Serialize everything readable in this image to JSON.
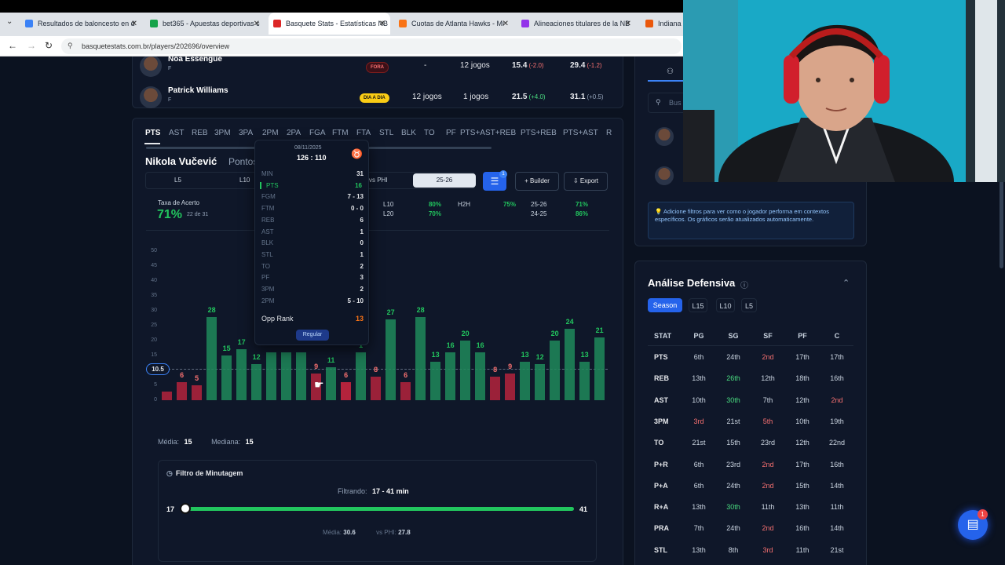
{
  "browser": {
    "tabs": [
      {
        "title": "Resultados de baloncesto en d",
        "color": "#3b82f6"
      },
      {
        "title": "bet365 - Apuestas deportivas c",
        "color": "#16a34a"
      },
      {
        "title": "Basquete Stats - Estatísticas NB",
        "color": "#dc2626"
      },
      {
        "title": "Cuotas de Atlanta Hawks - Mi",
        "color": "#f97316"
      },
      {
        "title": "Alineaciones titulares de la NB",
        "color": "#9333ea"
      },
      {
        "title": "Indiana I",
        "color": "#ea580c"
      }
    ],
    "url": "basquetestats.com.br/players/202696/overview"
  },
  "players": [
    {
      "name": "Noa Essengue",
      "pos": "F",
      "status": "FORA",
      "games": "-",
      "games2": "12 jogos",
      "val1": "15.4",
      "d1": "(-2.0)",
      "val2": "29.4",
      "d2": "(-1.2)"
    },
    {
      "name": "Patrick Williams",
      "pos": "F",
      "status": "DIA A DIA",
      "games": "12 jogos",
      "games2": "1 jogos",
      "val1": "21.5",
      "d1": "(+4.0)",
      "val2": "31.1",
      "d2": "(+0.5)"
    }
  ],
  "stat_tabs": [
    "PTS",
    "AST",
    "REB",
    "3PM",
    "3PA",
    "2PM",
    "2PA",
    "FGA",
    "FTM",
    "FTA",
    "STL",
    "BLK",
    "TO",
    "PF",
    "PTS+AST+REB",
    "PTS+REB",
    "PTS+AST",
    "R"
  ],
  "player": {
    "name": "Nikola Vučević",
    "subtitle": "Pontos",
    "filters": [
      "L5",
      "L10",
      "vs PHI",
      "25-26"
    ],
    "filter_badge": "1",
    "builder": "Builder",
    "export": "Export",
    "hit_rate_label": "Taxa de Acerto",
    "hit_rate": "71%",
    "hit_rate_sub": "22 de 31",
    "splits": [
      {
        "k": "L10",
        "v": "80%"
      },
      {
        "k": "L20",
        "v": "70%"
      },
      {
        "k": "H2H",
        "v": "75%"
      },
      {
        "k": "25-26",
        "v": "71%"
      },
      {
        "k": "24-25",
        "v": "86%"
      }
    ]
  },
  "tooltip": {
    "date": "08/11/2025",
    "score": "126 : 110",
    "rows": [
      {
        "k": "MIN",
        "v": "31"
      },
      {
        "k": "PTS",
        "v": "16"
      },
      {
        "k": "FGM",
        "v": "7 - 13"
      },
      {
        "k": "FTM",
        "v": "0 - 0"
      },
      {
        "k": "REB",
        "v": "6"
      },
      {
        "k": "AST",
        "v": "1"
      },
      {
        "k": "BLK",
        "v": "0"
      },
      {
        "k": "STL",
        "v": "1"
      },
      {
        "k": "TO",
        "v": "2"
      },
      {
        "k": "PF",
        "v": "3"
      },
      {
        "k": "3PM",
        "v": "2"
      },
      {
        "k": "2PM",
        "v": "5 - 10"
      }
    ],
    "opp_rank_label": "Opp Rank",
    "opp_rank": "13",
    "tag": "Regular"
  },
  "chart_data": {
    "type": "bar",
    "ylim": [
      0,
      50
    ],
    "yticks": [
      0,
      5,
      10,
      15,
      20,
      25,
      30,
      35,
      40,
      45,
      50
    ],
    "line": 10.5,
    "line_label": "10.5",
    "values": [
      3,
      6,
      5,
      28,
      15,
      17,
      12,
      16,
      16,
      16,
      9,
      11,
      6,
      16,
      8,
      27,
      6,
      28,
      13,
      16,
      20,
      16,
      8,
      9,
      13,
      12,
      20,
      24,
      13,
      21
    ],
    "labels_shown": {
      "1": "6",
      "2": "5",
      "3": "28",
      "4": "15",
      "5": "17",
      "6": "12",
      "10": "9",
      "11": "11",
      "12": "6",
      "13": "1",
      "14": "8",
      "15": "27",
      "16": "6",
      "17": "28",
      "18": "13",
      "19": "16",
      "20": "20",
      "21": "16",
      "22": "8",
      "23": "9",
      "24": "13",
      "25": "12",
      "26": "20",
      "27": "24",
      "28": "13",
      "29": "21"
    },
    "hit_color": "#1f8a5b",
    "miss_color": "#b4233c"
  },
  "summary": {
    "media_label": "Média:",
    "media": "15",
    "mediana_label": "Mediana:",
    "mediana": "15"
  },
  "minutes_filter": {
    "title": "Filtro de Minutagem",
    "filtering_label": "Filtrando:",
    "filtering": "17 - 41 min",
    "min": "17",
    "max": "41",
    "avg_label": "Média:",
    "avg": "30.6",
    "vs_label": "vs PHI:",
    "vs": "27.8"
  },
  "sidebar": {
    "search_placeholder": "Bus",
    "hint": "Adicione filtros para ver como o jogador performa em contextos específicos. Os gráficos serão atualizados automaticamente.",
    "defense_title": "Análise Defensiva",
    "periods": [
      "Season",
      "L15",
      "L10",
      "L5"
    ],
    "columns": [
      "STAT",
      "PG",
      "SG",
      "SF",
      "PF",
      "C"
    ],
    "rows": [
      {
        "stat": "PTS",
        "v": [
          "6th",
          "24th",
          "2nd",
          "17th",
          "17th"
        ]
      },
      {
        "stat": "REB",
        "v": [
          "13th",
          "26th",
          "12th",
          "18th",
          "16th"
        ]
      },
      {
        "stat": "AST",
        "v": [
          "10th",
          "30th",
          "7th",
          "12th",
          "2nd"
        ]
      },
      {
        "stat": "3PM",
        "v": [
          "3rd",
          "21st",
          "5th",
          "10th",
          "19th"
        ]
      },
      {
        "stat": "TO",
        "v": [
          "21st",
          "15th",
          "23rd",
          "12th",
          "22nd"
        ]
      },
      {
        "stat": "P+R",
        "v": [
          "6th",
          "23rd",
          "2nd",
          "17th",
          "16th"
        ]
      },
      {
        "stat": "P+A",
        "v": [
          "6th",
          "24th",
          "2nd",
          "15th",
          "14th"
        ]
      },
      {
        "stat": "R+A",
        "v": [
          "13th",
          "30th",
          "11th",
          "13th",
          "11th"
        ]
      },
      {
        "stat": "PRA",
        "v": [
          "7th",
          "24th",
          "2nd",
          "16th",
          "14th"
        ]
      },
      {
        "stat": "STL",
        "v": [
          "13th",
          "8th",
          "3rd",
          "11th",
          "21st"
        ]
      }
    ],
    "notif_count": "1"
  }
}
